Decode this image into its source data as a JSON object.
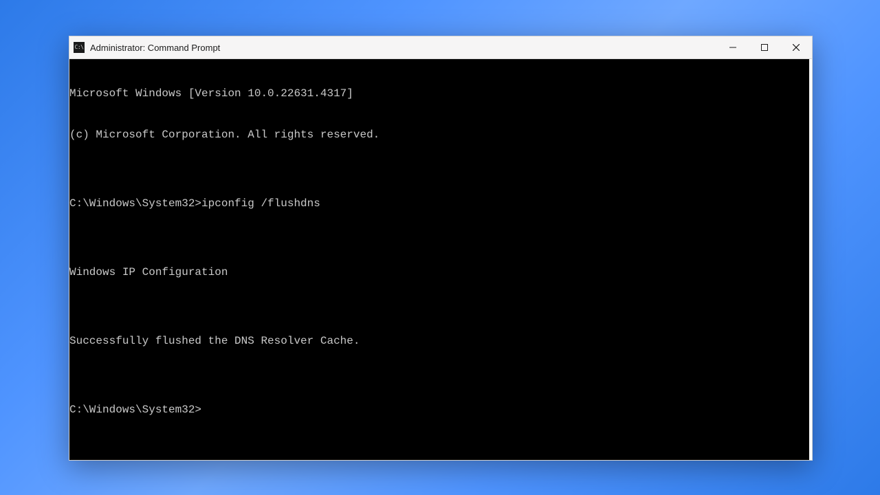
{
  "titlebar": {
    "icon_label": "C:\\",
    "title": "Administrator: Command Prompt"
  },
  "terminal": {
    "lines": [
      "Microsoft Windows [Version 10.0.22631.4317]",
      "(c) Microsoft Corporation. All rights reserved.",
      "",
      "C:\\Windows\\System32>ipconfig /flushdns",
      "",
      "Windows IP Configuration",
      "",
      "Successfully flushed the DNS Resolver Cache.",
      "",
      "C:\\Windows\\System32>"
    ]
  }
}
